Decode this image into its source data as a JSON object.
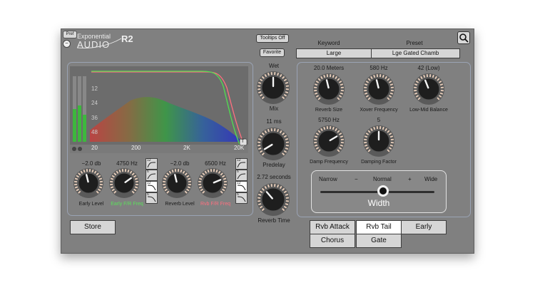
{
  "header": {
    "pref": "Pref",
    "minus": "−",
    "brand_line1": "Exponential",
    "brand_line2": "AUDIO",
    "product": "R2"
  },
  "top": {
    "tooltips": "Tooltips Off",
    "favorite": "Favorite"
  },
  "keyword": {
    "label": "Keyword",
    "value": "Large"
  },
  "preset": {
    "label": "Preset",
    "value": "Lge Gated Chamb"
  },
  "graph": {
    "db_ticks": [
      "12",
      "24",
      "36",
      "48"
    ],
    "freq_ticks": [
      "20",
      "200",
      "2K",
      "20K"
    ],
    "corner": "T"
  },
  "early": {
    "level": {
      "value": "−2.0 db",
      "label": "Early Level",
      "fraction": 0.45
    },
    "fir": {
      "value": "4750 Hz",
      "label": "Early F/R Freq",
      "fraction": 0.7
    }
  },
  "reverb_lvl": {
    "level": {
      "value": "−2.0 db",
      "label": "Reverb Level",
      "fraction": 0.45
    },
    "fir": {
      "value": "6500 Hz",
      "label": "Rvb F/R Freq",
      "fraction": 0.75
    }
  },
  "filters_left": [
    "12",
    "6",
    "12",
    "6"
  ],
  "filters_right": [
    "12",
    "6",
    "12",
    "6"
  ],
  "middle": {
    "wet": {
      "label": "Wet",
      "sub": "Mix",
      "fraction": 0.5
    },
    "predelay": {
      "value": "11 ms",
      "label": "Predelay",
      "fraction": 0.05
    },
    "reverb_time": {
      "value": "2.72 seconds",
      "label": "Reverb Time",
      "fraction": 0.35
    }
  },
  "params": {
    "reverb_size": {
      "value": "20.0 Meters",
      "label": "Reverb Size",
      "fraction": 0.45
    },
    "xover": {
      "value": "580 Hz",
      "label": "Xover Frequency",
      "fraction": 0.45
    },
    "low_mid": {
      "value": "42 (Low)",
      "label": "Low-Mid Balance",
      "fraction": 0.42
    },
    "damp_freq": {
      "value": "5750 Hz",
      "label": "Damp Frequency",
      "fraction": 0.72
    },
    "damp_factor": {
      "value": "5",
      "label": "Damping Factor",
      "fraction": 0.5
    }
  },
  "width": {
    "left": "Narrow",
    "minus": "−",
    "center": "Normal",
    "plus": "+",
    "right": "Wide",
    "label": "Width",
    "fraction": 0.55
  },
  "buttons": {
    "store": "Store",
    "rvb_attack": "Rvb Attack",
    "rvb_tail": "Rvb Tail",
    "early": "Early",
    "chorus": "Chorus",
    "gate": "Gate"
  },
  "colors": {
    "panel": "#808080",
    "green_label": "#5be05b",
    "pink_label": "#ff6f7f",
    "knob_tick": "#ead0bc"
  }
}
